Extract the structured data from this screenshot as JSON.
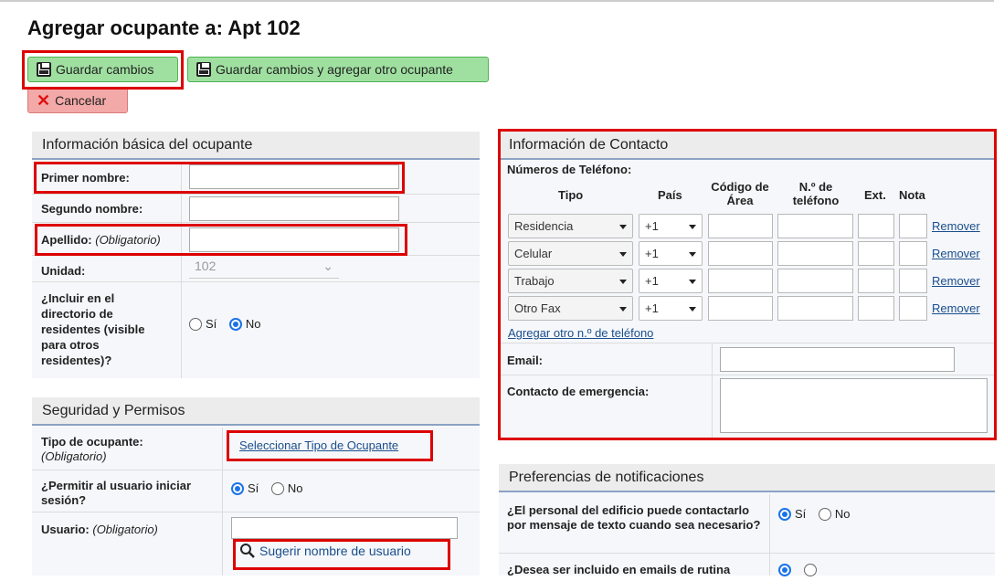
{
  "page": {
    "title": "Agregar ocupante a: Apt 102"
  },
  "toolbar": {
    "save_label": "Guardar cambios",
    "save_add_label": "Guardar cambios y agregar otro ocupante",
    "cancel_label": "Cancelar"
  },
  "basic": {
    "heading": "Información básica del ocupante",
    "first_name_label": "Primer nombre:",
    "middle_name_label": "Segundo nombre:",
    "last_name_label": "Apellido:",
    "last_name_note": "(Obligatorio)",
    "unit_label": "Unidad:",
    "unit_value": "102",
    "directory_label": "¿Incluir en el directorio de residentes (visible para otros residentes)?",
    "directory_yes": "Sí",
    "directory_no": "No"
  },
  "security": {
    "heading": "Seguridad y Permisos",
    "type_label": "Tipo de ocupante:",
    "type_note": "(Obligatorio)",
    "type_link": "Seleccionar Tipo de Ocupante",
    "login_label": "¿Permitir al usuario iniciar sesión?",
    "login_yes": "Sí",
    "login_no": "No",
    "user_label": "Usuario:",
    "user_note": "(Obligatorio)",
    "suggest_label": "Sugerir nombre de usuario"
  },
  "contact": {
    "heading": "Información de Contacto",
    "phones_label": "Números de Teléfono:",
    "col_type": "Tipo",
    "col_country": "País",
    "col_area": "Código de Área",
    "col_number": "N.º de teléfono",
    "col_ext": "Ext.",
    "col_note": "Nota",
    "phones": [
      {
        "type": "Residencia",
        "country": "+1",
        "remove": "Remover"
      },
      {
        "type": "Celular",
        "country": "+1",
        "remove": "Remover"
      },
      {
        "type": "Trabajo",
        "country": "+1",
        "remove": "Remover"
      },
      {
        "type": "Otro Fax",
        "country": "+1",
        "remove": "Remover"
      }
    ],
    "add_phone": "Agregar otro n.º de teléfono",
    "email_label": "Email:",
    "emergency_label": "Contacto de emergencia:"
  },
  "notifications": {
    "heading": "Preferencias de notificaciones",
    "sms_label": "¿El personal del edificio puede contactarlo por mensaje de texto cuando sea necesario?",
    "sms_yes": "Sí",
    "sms_no": "No",
    "emails_label": "¿Desea ser incluido en emails de rutina"
  },
  "colors": {
    "accent": "#1a73e8",
    "highlight": "#dd0000",
    "save_bg": "#9fe0a0",
    "cancel_bg": "#f2a9a7"
  }
}
